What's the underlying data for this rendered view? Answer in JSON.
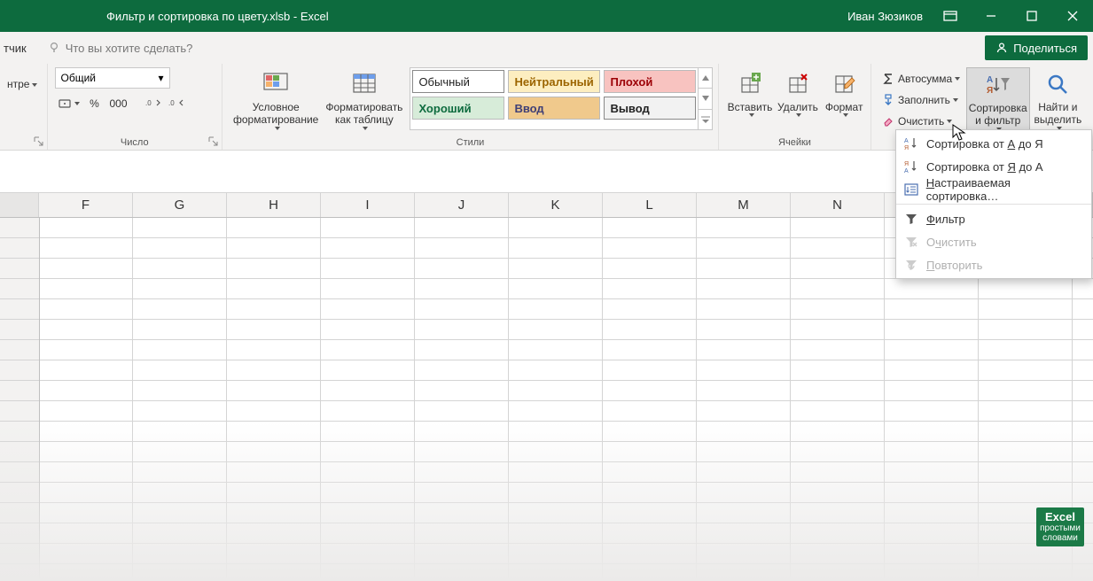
{
  "titlebar": {
    "filename": "Фильтр и сортировка по цвету.xlsb  -  Excel",
    "user": "Иван Зюзиков"
  },
  "tellme": {
    "left_fragment": "тчик",
    "placeholder": "Что вы хотите сделать?",
    "share": "Поделиться"
  },
  "ribbon": {
    "alignment": {
      "fragment": "нтре",
      "label": ""
    },
    "number": {
      "label": "Число",
      "format": "Общий",
      "percent": "%",
      "thousands": "000"
    },
    "styles": {
      "label": "Стили",
      "cond_format": "Условное\nформатирование",
      "format_table": "Форматировать\nкак таблицу",
      "cells": {
        "normal": {
          "text": "Обычный",
          "fg": "#222",
          "bg": "#ffffff"
        },
        "neutral": {
          "text": "Нейтральный",
          "fg": "#9c6500",
          "bg": "#fdeec0"
        },
        "bad": {
          "text": "Плохой",
          "fg": "#9c0006",
          "bg": "#f8c3c0"
        },
        "good": {
          "text": "Хороший",
          "fg": "#0d6b3e",
          "bg": "#d7ecd9"
        },
        "input": {
          "text": "Ввод",
          "fg": "#3f3f76",
          "bg": "#f0c98c"
        },
        "output": {
          "text": "Вывод",
          "fg": "#222",
          "bg": "#f2f2f2"
        }
      }
    },
    "cells_group": {
      "label": "Ячейки",
      "insert": "Вставить",
      "delete": "Удалить",
      "format": "Формат"
    },
    "editing": {
      "autosum": "Автосумма",
      "fill": "Заполнить",
      "clear": "Очистить",
      "sort_filter": "Сортировка\nи фильтр",
      "find_select": "Найти и\nвыделить"
    }
  },
  "grid": {
    "columns": [
      "F",
      "G",
      "H",
      "I",
      "J",
      "K",
      "L",
      "M",
      "N"
    ]
  },
  "menu": {
    "sort_az": "Сортировка от А до Я",
    "sort_za": "Сортировка от Я до А",
    "custom_sort": "Настраиваемая сортировка…",
    "filter": "Фильтр",
    "clear": "Очистить",
    "reapply": "Повторить"
  },
  "watermark": {
    "line1": "Excel",
    "line2": "простыми",
    "line3": "словами"
  }
}
